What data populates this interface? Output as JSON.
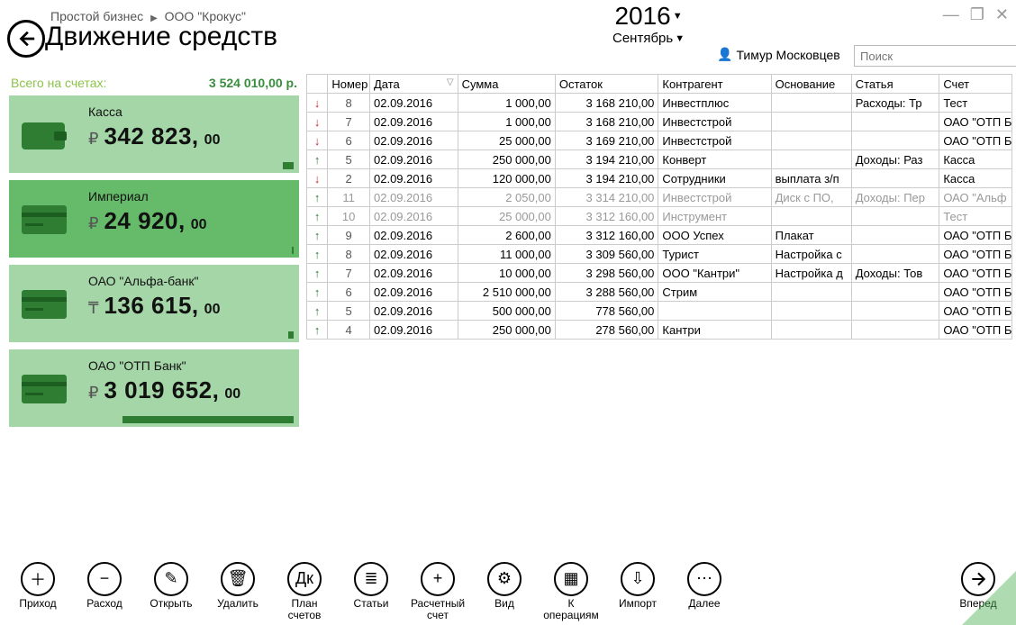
{
  "breadcrumb": {
    "a": "Простой бизнес",
    "b": "ООО \"Крокус\""
  },
  "page_title": "Движение средств",
  "period": {
    "year": "2016",
    "month": "Сентябрь"
  },
  "user": "Тимур Московцев",
  "search": {
    "placeholder": "Поиск"
  },
  "total": {
    "label": "Всего на счетах:",
    "value": "3 524 010,00 р."
  },
  "accounts": [
    {
      "name": "Касса",
      "currency": "₽",
      "major": "342 823,",
      "minor": "00",
      "dark": false,
      "bar": "w12"
    },
    {
      "name": "Империал",
      "currency": "₽",
      "major": "24 920,",
      "minor": "00",
      "dark": true,
      "bar": "w2"
    },
    {
      "name": "ОАО \"Альфа-банк\"",
      "currency": "₸",
      "major": "136 615,",
      "minor": "00",
      "dark": false,
      "bar": "w6"
    },
    {
      "name": "ОАО \"ОТП Банк\"",
      "currency": "₽",
      "major": "3 019 652,",
      "minor": "00",
      "dark": false,
      "bar": "w190"
    }
  ],
  "columns": {
    "num": "Номер",
    "date": "Дата",
    "sum": "Сумма",
    "bal": "Остаток",
    "cag": "Контрагент",
    "osn": "Основание",
    "st": "Статья",
    "acc": "Счет"
  },
  "rows": [
    {
      "dir": "dn",
      "num": "8",
      "date": "02.09.2016",
      "sum": "1 000,00",
      "bal": "3 168 210,00",
      "cag": "Инвестплюс",
      "osn": "",
      "st": "Расходы: Тр",
      "acc": "Тест"
    },
    {
      "dir": "dn",
      "num": "7",
      "date": "02.09.2016",
      "sum": "1 000,00",
      "bal": "3 168 210,00",
      "cag": "Инвестстрой",
      "osn": "",
      "st": "",
      "acc": "ОАО \"ОТП Б"
    },
    {
      "dir": "dn",
      "num": "6",
      "date": "02.09.2016",
      "sum": "25 000,00",
      "bal": "3 169 210,00",
      "cag": "Инвестстрой",
      "osn": "",
      "st": "",
      "acc": "ОАО \"ОТП Б"
    },
    {
      "dir": "up",
      "num": "5",
      "date": "02.09.2016",
      "sum": "250 000,00",
      "bal": "3 194 210,00",
      "cag": "Конверт",
      "osn": "",
      "st": "Доходы: Раз",
      "acc": "Касса"
    },
    {
      "dir": "dn",
      "num": "2",
      "date": "02.09.2016",
      "sum": "120 000,00",
      "bal": "3 194 210,00",
      "cag": "Сотрудники",
      "osn": "выплата з/п",
      "st": "",
      "acc": "Касса"
    },
    {
      "dir": "up",
      "num": "11",
      "date": "02.09.2016",
      "sum": "2 050,00",
      "bal": "3 314 210,00",
      "cag": "Инвестстрой",
      "osn": "Диск с ПО,",
      "st": "Доходы: Пер",
      "acc": "ОАО \"Альф",
      "faded": true
    },
    {
      "dir": "up",
      "num": "10",
      "date": "02.09.2016",
      "sum": "25 000,00",
      "bal": "3 312 160,00",
      "cag": "Инструмент",
      "osn": "",
      "st": "",
      "acc": "Тест",
      "faded": true
    },
    {
      "dir": "up",
      "num": "9",
      "date": "02.09.2016",
      "sum": "2 600,00",
      "bal": "3 312 160,00",
      "cag": "ООО Успех",
      "osn": "Плакат",
      "st": "",
      "acc": "ОАО \"ОТП Б"
    },
    {
      "dir": "up",
      "num": "8",
      "date": "02.09.2016",
      "sum": "11 000,00",
      "bal": "3 309 560,00",
      "cag": "Турист",
      "osn": "Настройка с",
      "st": "",
      "acc": "ОАО \"ОТП Б"
    },
    {
      "dir": "up",
      "num": "7",
      "date": "02.09.2016",
      "sum": "10 000,00",
      "bal": "3 298 560,00",
      "cag": "ООО \"Кантри\"",
      "osn": "Настройка д",
      "st": "Доходы: Тов",
      "acc": "ОАО \"ОТП Б"
    },
    {
      "dir": "up",
      "num": "6",
      "date": "02.09.2016",
      "sum": "2 510 000,00",
      "bal": "3 288 560,00",
      "cag": "Стрим",
      "osn": "",
      "st": "",
      "acc": "ОАО \"ОТП Б"
    },
    {
      "dir": "up",
      "num": "5",
      "date": "02.09.2016",
      "sum": "500 000,00",
      "bal": "778 560,00",
      "cag": "",
      "osn": "",
      "st": "",
      "acc": "ОАО \"ОТП Б"
    },
    {
      "dir": "up",
      "num": "4",
      "date": "02.09.2016",
      "sum": "250 000,00",
      "bal": "278 560,00",
      "cag": "Кантри",
      "osn": "",
      "st": "",
      "acc": "ОАО \"ОТП Б"
    }
  ],
  "toolbar": [
    {
      "id": "income",
      "label": "Приход",
      "glyph": "＋"
    },
    {
      "id": "expense",
      "label": "Расход",
      "glyph": "−"
    },
    {
      "id": "open",
      "label": "Открыть",
      "glyph": "✎"
    },
    {
      "id": "delete",
      "label": "Удалить",
      "glyph": "🗑"
    },
    {
      "id": "plan",
      "label": "План\nсчетов",
      "glyph": "Дк"
    },
    {
      "id": "articles",
      "label": "Статьи",
      "glyph": "≣"
    },
    {
      "id": "account",
      "label": "Расчетный\nсчет",
      "glyph": "+"
    },
    {
      "id": "view",
      "label": "Вид",
      "glyph": "⚙"
    },
    {
      "id": "toops",
      "label": "К операциям",
      "glyph": "▦"
    },
    {
      "id": "import",
      "label": "Импорт",
      "glyph": "⇩"
    },
    {
      "id": "more",
      "label": "Далее",
      "glyph": "⋯"
    }
  ],
  "forward_label": "Вперед"
}
